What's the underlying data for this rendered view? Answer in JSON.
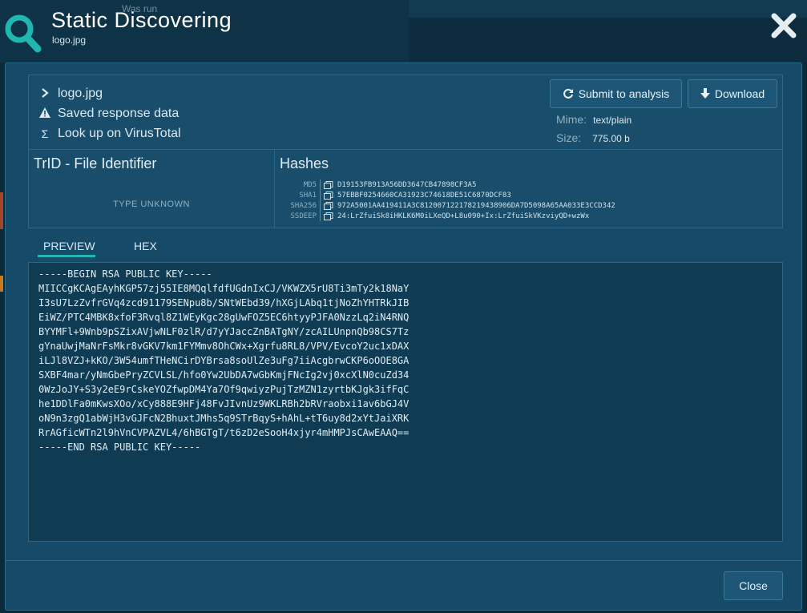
{
  "background": {
    "was_run": "Was run"
  },
  "header": {
    "title": "Static Discovering",
    "subtitle": "logo.jpg",
    "accent": "#1fb7b0"
  },
  "info": {
    "filename": "logo.jpg",
    "saved_response": "Saved response data",
    "virustotal": "Look up on VirusTotal",
    "submit_label": "Submit to analysis",
    "download_label": "Download",
    "mime_label": "Mime:",
    "mime_value": "text/plain",
    "size_label": "Size:",
    "size_value": "775.00 b"
  },
  "trid": {
    "title": "TrID - File Identifier",
    "result": "TYPE UNKNOWN"
  },
  "hashes": {
    "title": "Hashes",
    "rows": [
      {
        "key": "MD5",
        "value": "D19153FB913A56DD3647CB47898CF3A5"
      },
      {
        "key": "SHA1",
        "value": "57EBBF0254660CA31923C74618DE51C6870DCF83"
      },
      {
        "key": "SHA256",
        "value": "972A5001AA419411A3C812007122178219438906DA7D5098A65AA033E3CCD342"
      },
      {
        "key": "SSDEEP",
        "value": "24:LrZfuiSk8iHKLK6M0iLXeQD+L8u090+Ix:LrZfuiSkVKzviyQD+wzWx"
      }
    ]
  },
  "tabs": {
    "preview": "PREVIEW",
    "hex": "HEX"
  },
  "preview": {
    "content": "-----BEGIN RSA PUBLIC KEY-----\nMIICCgKCAgEAyhKGP57zj55IE8MQqlfdfUGdnIxCJ/VKWZX5rU8Ti3mTy2k18NaY\nI3sU7LzZvfrGVq4zcd91179SENpu8b/SNtWEbd39/hXGjLAbq1tjNoZhYHTRkJIB\nEiWZ/PTC4MBK8xfoF3Rvql8Z1WEyKgc28gUwFOZ5EC6htyyPJFA0NzzLq2iN4RNQ\nBYYMFl+9Wnb9pSZixAVjwNLF0zlR/d7yYJaccZnBATgNY/zcAILUnpnQb98CS7Tz\ngYnaUwjMaNrFsMkr8vGKV7km1FYMmv8OhCWx+Xgrfu8RL8/VPV/EvcoY2uc1xDAX\niLJl8VZJ+kKO/3W54umfTHeNCirDYBrsa8soUlZe3uFg7iiAcgbrwCKP6oOOE8GA\nSXBF4mar/yNmGbePryZCVLSL/hfo0Yw2UbDA7wGbKmjFNcIg2vj0xcXlN0cuZd34\n0WzJoJY+S3y2eE9rCskeYOZfwpDM4Ya7Of9qwiyzPujTzMZN1zyrtbKJgk3ifFqC\nhe1DDlFa0mKwsXOo/xCy888E9HFj48FvJIvnUz9WKLRBh2bRVraobxi1av6bGJ4V\noN9n3zgQ1abWjH3vGJFcN2BhuxtJMhs5q9STrBqyS+hAhL+tT6uy8d2xYtJaiXRK\nRrAGficWTn2l9hVnCVPAZVL4/6hBGTgT/t6zD2eSooH4xjyr4mHMPJsCAwEAAQ==\n-----END RSA PUBLIC KEY-----"
  },
  "footer": {
    "close_label": "Close"
  }
}
